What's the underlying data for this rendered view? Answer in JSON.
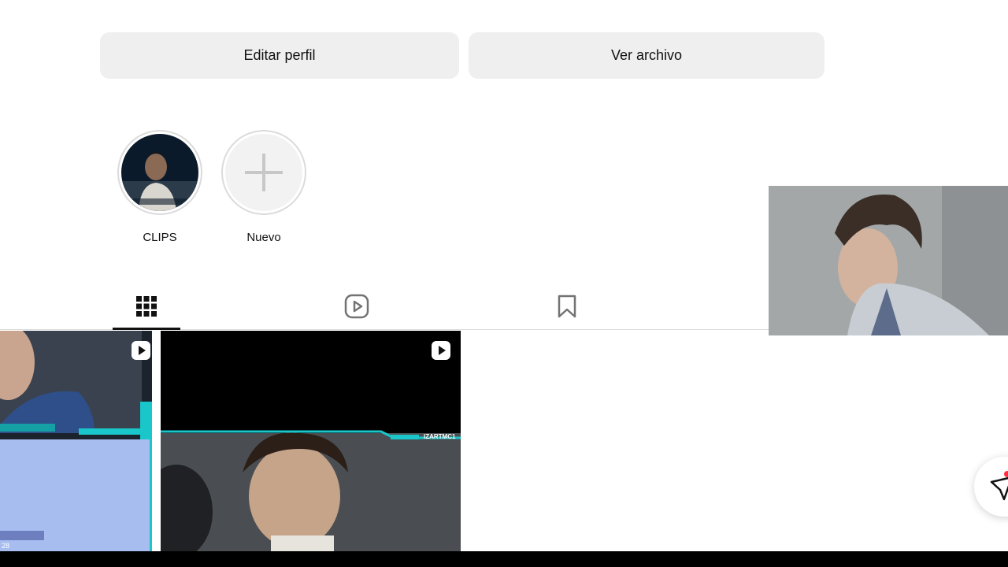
{
  "header": {
    "cut_text": "· · ·"
  },
  "actions": {
    "edit_profile": "Editar perfil",
    "view_archive": "Ver archivo"
  },
  "highlights": [
    {
      "label": "CLIPS",
      "icon": "story-thumbnail"
    },
    {
      "label": "Nuevo",
      "icon": "plus-icon"
    }
  ],
  "tabs": [
    {
      "icon": "grid-icon",
      "active": true
    },
    {
      "icon": "reels-icon",
      "active": false
    },
    {
      "icon": "bookmark-icon",
      "active": false
    },
    {
      "icon": "tagged-icon",
      "active": false
    }
  ],
  "posts": [
    {
      "type": "video",
      "overlay_text": "28"
    },
    {
      "type": "video",
      "overlay_text": "IZARTMC1"
    }
  ],
  "colors": {
    "button_bg": "#efefef",
    "divider": "#dbdbdb",
    "accent_cyan": "#19c6c9"
  }
}
